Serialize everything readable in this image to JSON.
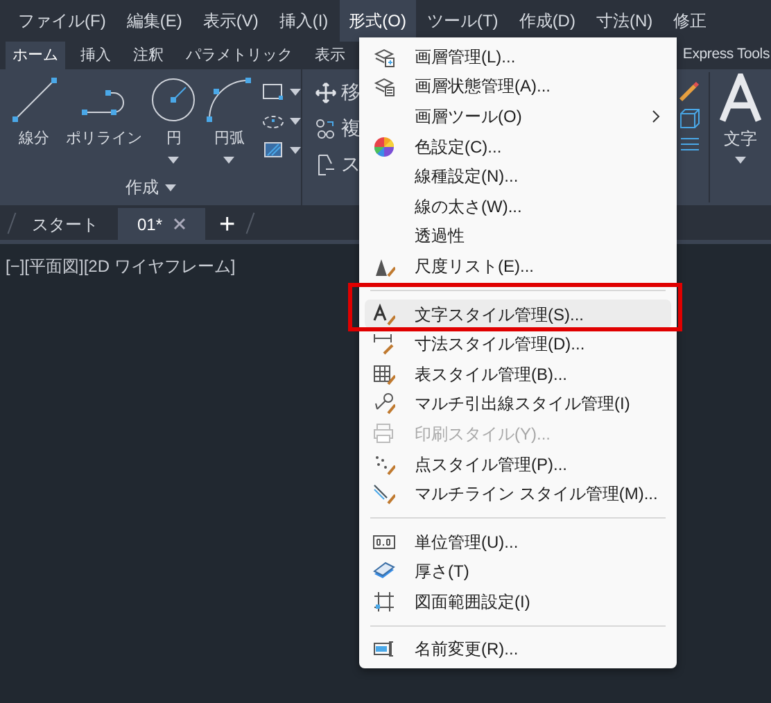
{
  "menubar": [
    {
      "label": "ファイル(F)",
      "selected": false
    },
    {
      "label": "編集(E)",
      "selected": false
    },
    {
      "label": "表示(V)",
      "selected": false
    },
    {
      "label": "挿入(I)",
      "selected": false
    },
    {
      "label": "形式(O)",
      "selected": true
    },
    {
      "label": "ツール(T)",
      "selected": false
    },
    {
      "label": "作成(D)",
      "selected": false
    },
    {
      "label": "寸法(N)",
      "selected": false
    },
    {
      "label": "修正",
      "selected": false
    }
  ],
  "ribbon_tabs": [
    {
      "label": "ホーム",
      "selected": true
    },
    {
      "label": "挿入",
      "selected": false
    },
    {
      "label": "注釈",
      "selected": false
    },
    {
      "label": "パラメトリック",
      "selected": false
    },
    {
      "label": "表示",
      "selected": false
    }
  ],
  "ribbon_extra_tab": "Express Tools",
  "draw_panel": {
    "tools": [
      {
        "label": "線分",
        "dropdown": false
      },
      {
        "label": "ポリライン",
        "dropdown": false
      },
      {
        "label": "円",
        "dropdown": true
      },
      {
        "label": "円弧",
        "dropdown": true
      }
    ],
    "title": "作成"
  },
  "modify_panel": {
    "labels": [
      "移",
      "複",
      "ス"
    ]
  },
  "text_panel": {
    "label": "文字"
  },
  "doc_tabs": [
    {
      "label": "スタート",
      "selected": false,
      "closable": false
    },
    {
      "label": "01*",
      "selected": true,
      "closable": true
    }
  ],
  "add_tab": "+",
  "viewport_label": "[−][平面図][2D ワイヤフレーム]",
  "format_menu": [
    {
      "kind": "item",
      "label": "画層管理(L)...",
      "disabled": false,
      "submenu": false,
      "highlighted": false
    },
    {
      "kind": "item",
      "label": "画層状態管理(A)...",
      "disabled": false,
      "submenu": false,
      "highlighted": false
    },
    {
      "kind": "item",
      "label": "画層ツール(O)",
      "disabled": false,
      "submenu": true,
      "highlighted": false
    },
    {
      "kind": "item",
      "label": "色設定(C)...",
      "disabled": false,
      "submenu": false,
      "highlighted": false
    },
    {
      "kind": "item",
      "label": "線種設定(N)...",
      "disabled": false,
      "submenu": false,
      "highlighted": false
    },
    {
      "kind": "item",
      "label": "線の太さ(W)...",
      "disabled": false,
      "submenu": false,
      "highlighted": false
    },
    {
      "kind": "item",
      "label": "透過性",
      "disabled": false,
      "submenu": false,
      "highlighted": false
    },
    {
      "kind": "item",
      "label": "尺度リスト(E)...",
      "disabled": false,
      "submenu": false,
      "highlighted": false
    },
    {
      "kind": "separator"
    },
    {
      "kind": "item",
      "label": "文字スタイル管理(S)...",
      "disabled": false,
      "submenu": false,
      "highlighted": true
    },
    {
      "kind": "item",
      "label": "寸法スタイル管理(D)...",
      "disabled": false,
      "submenu": false,
      "highlighted": false
    },
    {
      "kind": "item",
      "label": "表スタイル管理(B)...",
      "disabled": false,
      "submenu": false,
      "highlighted": false
    },
    {
      "kind": "item",
      "label": "マルチ引出線スタイル管理(I)",
      "disabled": false,
      "submenu": false,
      "highlighted": false
    },
    {
      "kind": "item",
      "label": "印刷スタイル(Y)...",
      "disabled": true,
      "submenu": false,
      "highlighted": false
    },
    {
      "kind": "item",
      "label": "点スタイル管理(P)...",
      "disabled": false,
      "submenu": false,
      "highlighted": false
    },
    {
      "kind": "item",
      "label": "マルチライン スタイル管理(M)...",
      "disabled": false,
      "submenu": false,
      "highlighted": false
    },
    {
      "kind": "separator"
    },
    {
      "kind": "item",
      "label": "単位管理(U)...",
      "disabled": false,
      "submenu": false,
      "highlighted": false
    },
    {
      "kind": "item",
      "label": "厚さ(T)",
      "disabled": false,
      "submenu": false,
      "highlighted": false
    },
    {
      "kind": "item",
      "label": "図面範囲設定(I)",
      "disabled": false,
      "submenu": false,
      "highlighted": false
    },
    {
      "kind": "separator"
    },
    {
      "kind": "item",
      "label": "名前変更(R)...",
      "disabled": false,
      "submenu": false,
      "highlighted": false
    }
  ]
}
